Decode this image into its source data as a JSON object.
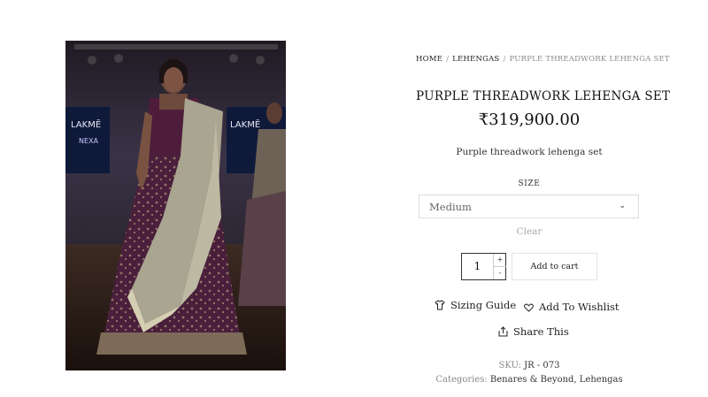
{
  "breadcrumb": {
    "home": "HOME",
    "sep1": "/",
    "category": "LEHENGAS",
    "sep2": "/",
    "current": "PURPLE THREADWORK LEHENGA SET"
  },
  "product": {
    "title": "PURPLE THREADWORK LEHENGA SET",
    "price": "₹319,900.00",
    "description": "Purple threadwork lehenga set"
  },
  "variant": {
    "size_label": "SIZE",
    "size_value": "Medium",
    "clear_label": "Clear"
  },
  "cart": {
    "quantity": "1",
    "plus": "+",
    "minus": "-",
    "add_label": "Add to cart"
  },
  "links": {
    "sizing_guide": "Sizing Guide",
    "wishlist": "Add To Wishlist",
    "share": "Share This"
  },
  "meta": {
    "sku_label": "SKU:",
    "sku_value": "JR - 073",
    "categories_label": "Categories:",
    "categories_value": "Benares & Beyond, Lehengas"
  },
  "image": {
    "backdrop_text": [
      "LAKMĒ",
      "NEXA",
      "LAKMĒ"
    ],
    "colors": {
      "backdrop": "#2b2530",
      "skirt": "#4a1f3c",
      "dupatta": "#a8a48f"
    }
  }
}
